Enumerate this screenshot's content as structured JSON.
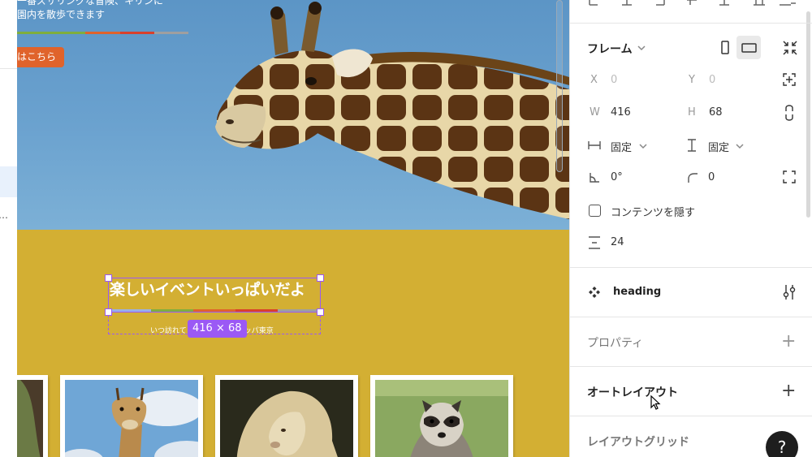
{
  "left_strip": {
    "overflow": "…"
  },
  "canvas": {
    "hero": {
      "line1": "一番ズサリングな冒険、キリンに",
      "line2": "園内を散歩できます",
      "cta": "はこちら",
      "stripe_colors": [
        "#7fae3e",
        "#e0632b",
        "#d9402b",
        "#9f9f9f"
      ]
    },
    "section": {
      "heading": "楽しいイベントいっぱいだよ",
      "sub_left": "いつ訪れて",
      "sub_right": "コッパ東京",
      "size_badge": "416 × 68",
      "stripe_colors": [
        "#9ab0e6",
        "#7fae3e",
        "#e0632b",
        "#d9402b",
        "#9f9f9f"
      ]
    }
  },
  "panel": {
    "frame": {
      "title": "フレーム",
      "x_label": "X",
      "x_value": "0",
      "y_label": "Y",
      "y_value": "0",
      "w_label": "W",
      "w_value": "416",
      "h_label": "H",
      "h_value": "68",
      "h_sizing": "固定",
      "v_sizing": "固定",
      "rotation": "0°",
      "radius": "0",
      "clip_content_label": "コンテンツを隠す",
      "gap": "24"
    },
    "component": {
      "name": "heading"
    },
    "properties_label": "プロパティ",
    "auto_layout_label": "オートレイアウト",
    "layout_grid_label": "レイアウトグリッド",
    "help": "?"
  }
}
